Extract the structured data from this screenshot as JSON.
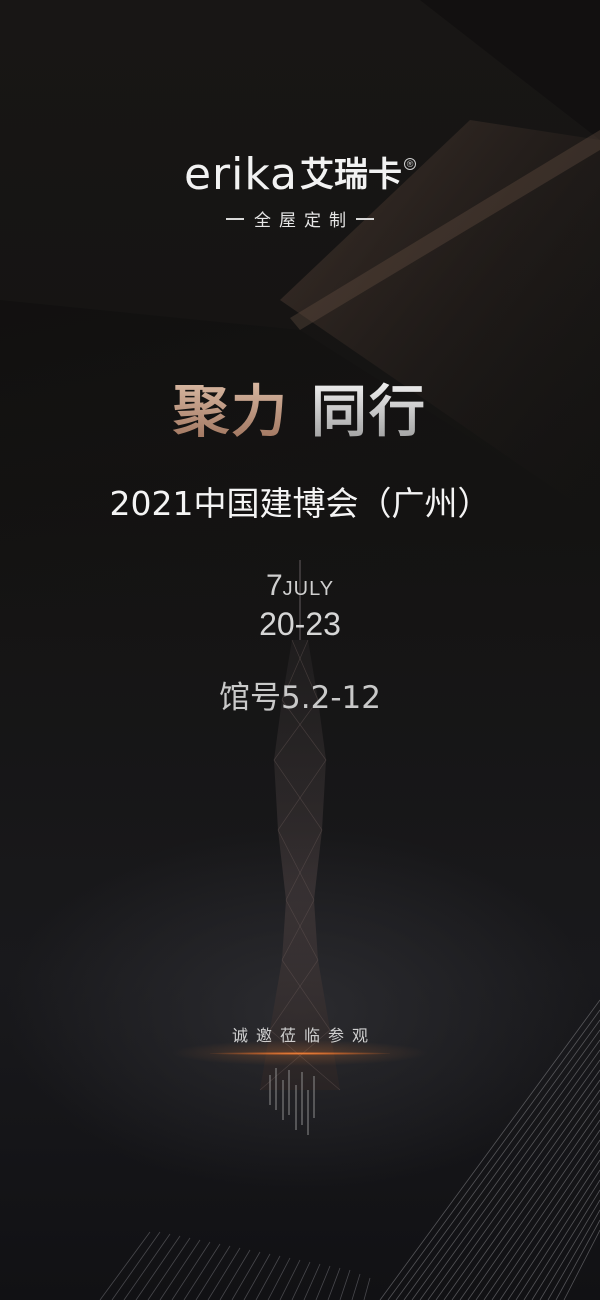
{
  "brand": {
    "latin": "erika",
    "chinese": "艾瑞卡",
    "registered": "®",
    "tagline": "全屋定制"
  },
  "headline": {
    "part_a": "聚力",
    "part_b": "同行"
  },
  "event": {
    "title": "2021中国建博会（广州）",
    "month_number": "7",
    "month_name": "JULY",
    "date_range": "20-23",
    "hall": "馆号5.2-12"
  },
  "invitation": "诚邀莅临参观",
  "colors": {
    "background": "#141312",
    "headline_bronze": "#b88a72",
    "accent_glow": "#ff8a3d",
    "text_light": "#f2f2f2"
  }
}
